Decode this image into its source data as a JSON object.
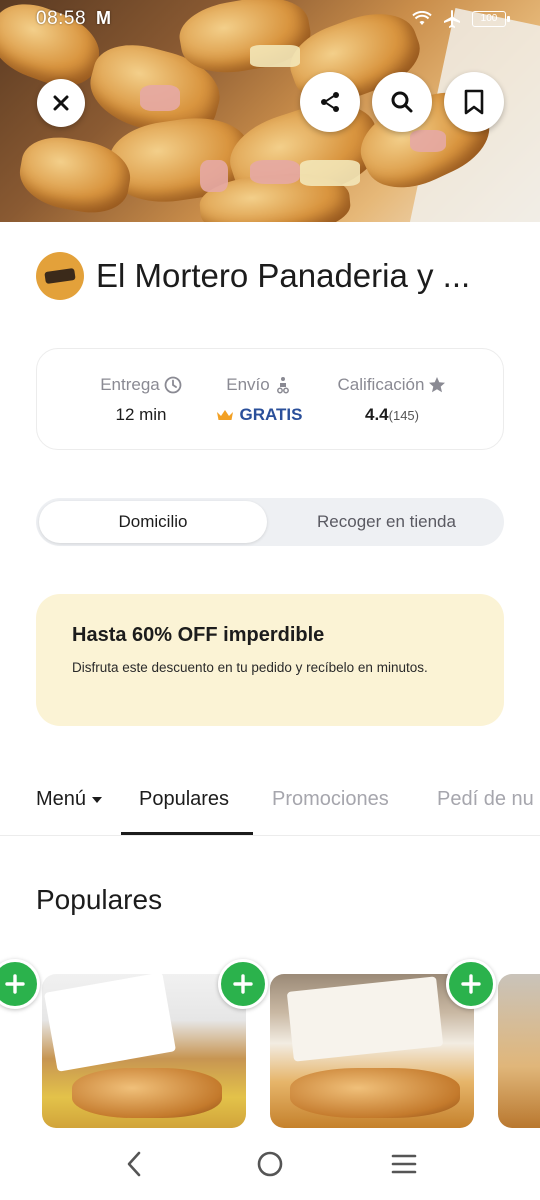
{
  "status_bar": {
    "time": "08:58",
    "notification": "M",
    "battery": "100"
  },
  "store": {
    "name": "El Mortero Panaderia y ..."
  },
  "info": {
    "delivery_label": "Entrega",
    "delivery_value": "12 min",
    "shipping_label": "Envío",
    "shipping_value": "GRATIS",
    "rating_label": "Calificación",
    "rating_value": "4.4",
    "rating_count": "(145)"
  },
  "colors": {
    "accent_green": "#2bb24c",
    "gratis_blue": "#2a4f9a",
    "promo_bg": "#fbf3d5",
    "crown_orange": "#f2a024"
  },
  "toggle": {
    "active": "Domicilio",
    "inactive": "Recoger en tienda"
  },
  "promo": {
    "title": "Hasta 60% OFF imperdible",
    "description": "Disfruta este descuento en tu pedido y recíbelo en minutos."
  },
  "tabs": {
    "menu": "Menú",
    "items": [
      "Populares",
      "Promociones",
      "Pedí de nu"
    ],
    "selected": "Populares"
  },
  "section": {
    "title": "Populares"
  },
  "icons": {
    "close": "close-icon",
    "share": "share-icon",
    "search": "search-icon",
    "bookmark": "bookmark-icon",
    "clock": "clock-icon",
    "delivery": "scooter-icon",
    "star": "star-icon",
    "crown": "crown-icon",
    "add": "plus-icon",
    "back": "back-icon",
    "home": "home-icon",
    "menu": "menu-icon"
  }
}
